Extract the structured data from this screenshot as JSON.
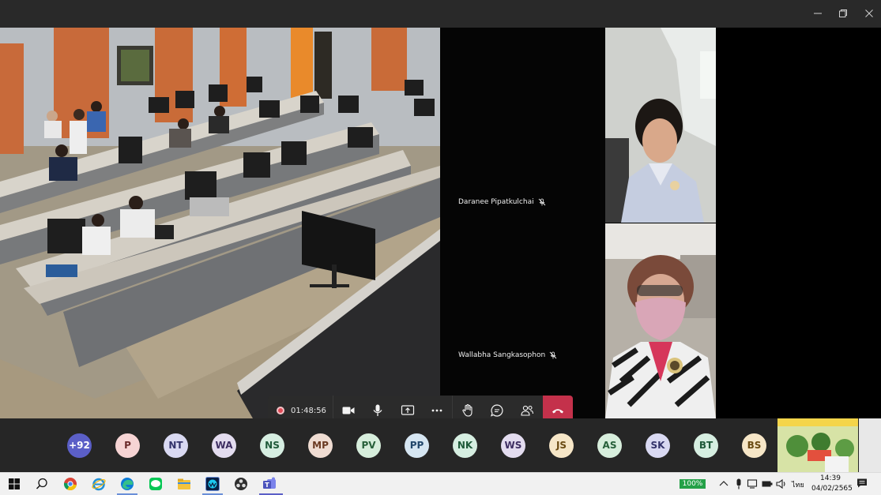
{
  "window": {
    "controls": [
      "minimize-icon",
      "restore-icon",
      "close-icon"
    ]
  },
  "stage": {
    "participants": [
      {
        "name": "Daranee Pipatkulchai",
        "muted": true
      },
      {
        "name": "Wallabha Sangkasophon",
        "muted": true
      }
    ]
  },
  "meeting_controls": {
    "recording_time": "01:48:56",
    "icons": [
      "camera-icon",
      "microphone-icon",
      "share-screen-icon",
      "more-icon",
      "raise-hand-icon",
      "chat-icon",
      "people-icon",
      "hang-up-icon"
    ],
    "accent": "#c4314b"
  },
  "participants_strip": {
    "overflow_count": "+92",
    "avatars": [
      {
        "initials": "P",
        "bg": "#f6d4d4",
        "fg": "#6b2b2b"
      },
      {
        "initials": "NT",
        "bg": "#d9d9f2",
        "fg": "#33336b"
      },
      {
        "initials": "WA",
        "bg": "#e3dcef",
        "fg": "#3f2f63"
      },
      {
        "initials": "NS",
        "bg": "#d6eee1",
        "fg": "#1f5a3a"
      },
      {
        "initials": "MP",
        "bg": "#efdcd2",
        "fg": "#6b3a22"
      },
      {
        "initials": "PV",
        "bg": "#d7eedc",
        "fg": "#27603a"
      },
      {
        "initials": "PP",
        "bg": "#d6e6f2",
        "fg": "#22476b"
      },
      {
        "initials": "NK",
        "bg": "#d6eee1",
        "fg": "#1f5a3a"
      },
      {
        "initials": "WS",
        "bg": "#e3dcef",
        "fg": "#3f2f63"
      },
      {
        "initials": "JS",
        "bg": "#f6e6c7",
        "fg": "#6b4b12"
      },
      {
        "initials": "AS",
        "bg": "#d7eedc",
        "fg": "#27603a"
      },
      {
        "initials": "SK",
        "bg": "#d9d9f2",
        "fg": "#33336b"
      },
      {
        "initials": "BT",
        "bg": "#d6eee1",
        "fg": "#1f5a3a"
      },
      {
        "initials": "BS",
        "bg": "#f6e6c7",
        "fg": "#6b4b12"
      }
    ],
    "overflow_bg": "#5b5fc7"
  },
  "taskbar": {
    "apps": [
      "windows-start-icon",
      "search-icon",
      "chrome-icon",
      "internet-explorer-icon",
      "edge-icon",
      "line-icon",
      "file-explorer-icon",
      "webex-icon",
      "obs-icon",
      "teams-icon"
    ],
    "battery": "100%",
    "language": "ไทย",
    "time": "14:39",
    "date": "04/02/2565"
  }
}
